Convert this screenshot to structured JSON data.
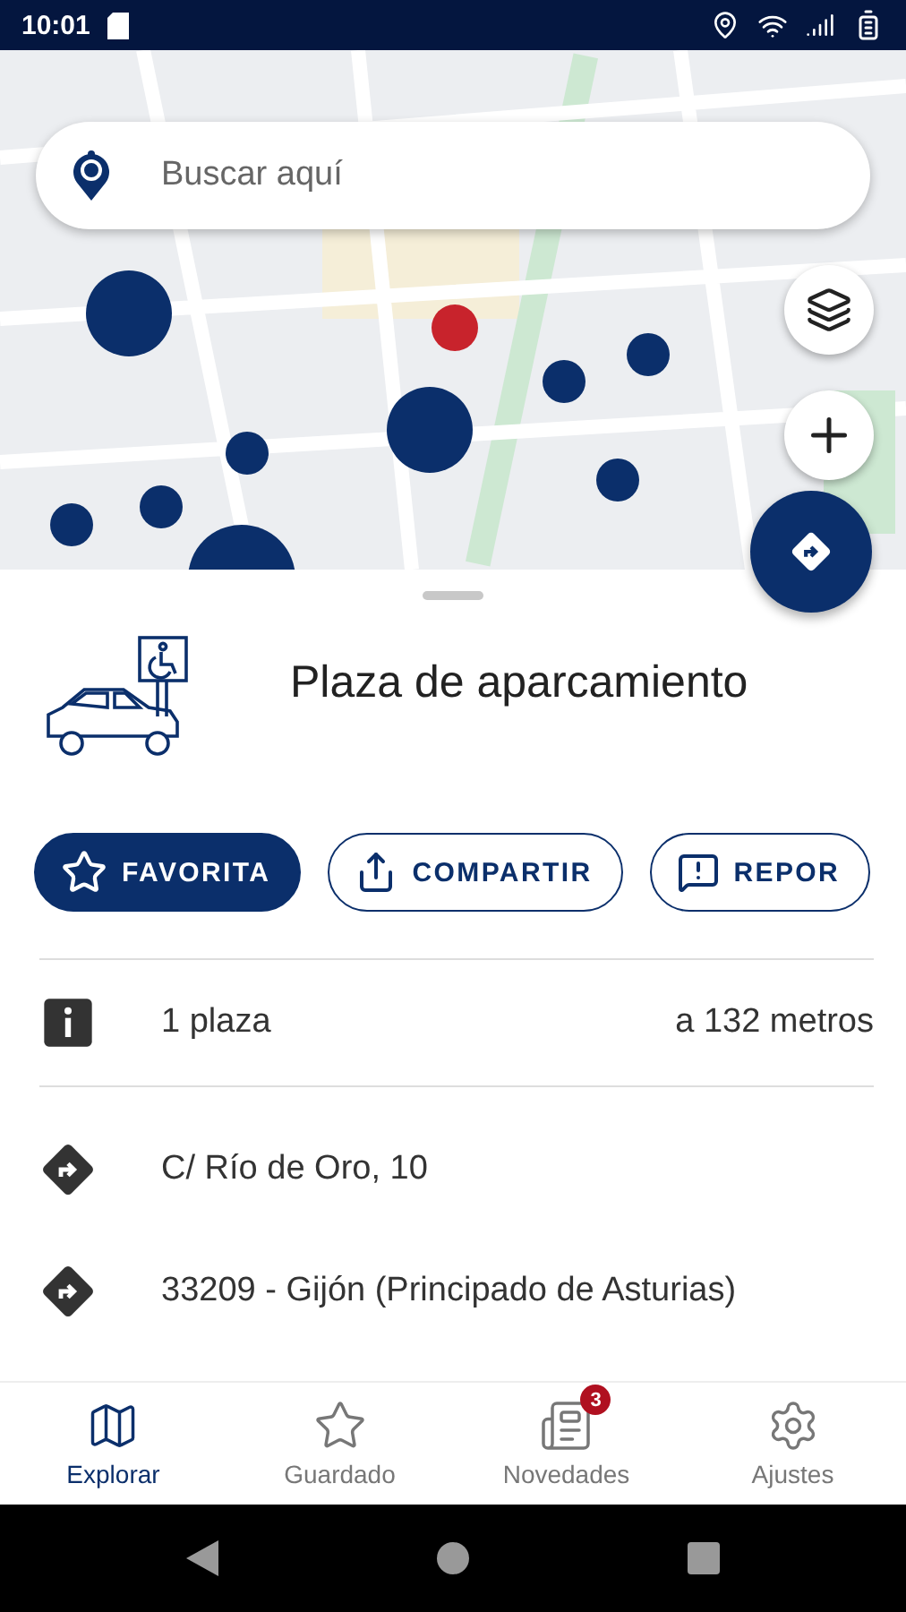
{
  "status_bar": {
    "time": "10:01"
  },
  "search": {
    "placeholder": "Buscar aquí"
  },
  "place": {
    "title": "Plaza de aparcamiento"
  },
  "actions": [
    {
      "label": "FAVORITA",
      "kind": "favorite",
      "filled": true
    },
    {
      "label": "COMPARTIR",
      "kind": "share",
      "filled": false
    },
    {
      "label": "REPOR",
      "kind": "report",
      "filled": false
    }
  ],
  "details": [
    {
      "kind": "info",
      "text": "1 plaza",
      "extra": "a 132 metros"
    },
    {
      "kind": "direction",
      "text": "C/ Río de Oro, 10"
    },
    {
      "kind": "direction",
      "text": "33209 - Gijón (Principado de Asturias)"
    }
  ],
  "nav": [
    {
      "label": "Explorar",
      "kind": "map",
      "selected": true
    },
    {
      "label": "Guardado",
      "kind": "star",
      "selected": false
    },
    {
      "label": "Novedades",
      "kind": "news",
      "selected": false,
      "badge": "3"
    },
    {
      "label": "Ajustes",
      "kind": "gear",
      "selected": false
    }
  ]
}
